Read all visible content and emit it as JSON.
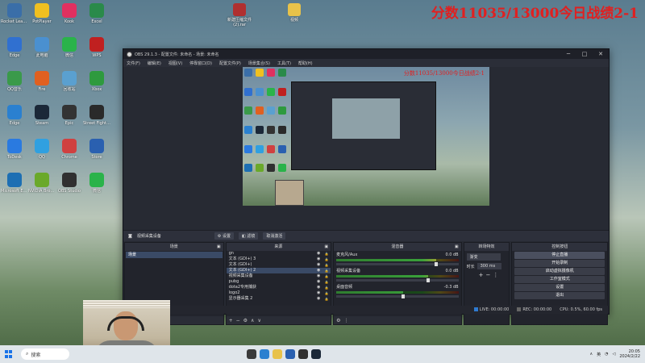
{
  "overlay_title": "分数11035/13000今日战绩2-1",
  "top_icons": [
    {
      "label": "新建压缩文件 (2).rar",
      "color": "#b03030",
      "icon": "archive-icon"
    },
    {
      "label": "视频",
      "color": "#e8c24a",
      "icon": "folder-icon"
    }
  ],
  "desktop_icons": [
    {
      "label": "Rocket\nLeague",
      "color": "#3a6ea8"
    },
    {
      "label": "PotPlayer",
      "color": "#f0c020"
    },
    {
      "label": "Kook",
      "color": "#e03060"
    },
    {
      "label": "Excel",
      "color": "#2a8a4a"
    },
    {
      "label": "Edge",
      "color": "#3070d0"
    },
    {
      "label": "此电脑",
      "color": "#4a90d0"
    },
    {
      "label": "微信",
      "color": "#2ab34a"
    },
    {
      "label": "WPS",
      "color": "#c02020"
    },
    {
      "label": "QQ音乐",
      "color": "#3a9a4a"
    },
    {
      "label": "Fire",
      "color": "#e06020"
    },
    {
      "label": "回收站",
      "color": "#5aa0d0"
    },
    {
      "label": "Xbox",
      "color": "#2e9a3e"
    },
    {
      "label": "Edge",
      "color": "#2a80d0"
    },
    {
      "label": "Steam",
      "color": "#1b2838"
    },
    {
      "label": "Epic",
      "color": "#333333"
    },
    {
      "label": "Street Fighter 6",
      "color": "#2a2a2a"
    },
    {
      "label": "ToDesk",
      "color": "#2a7ae0"
    },
    {
      "label": "QQ",
      "color": "#30a0e0"
    },
    {
      "label": "Chrome",
      "color": "#d04040"
    },
    {
      "label": "Store",
      "color": "#2a60b0"
    },
    {
      "label": "Microsoft Edge",
      "color": "#1d6fb3"
    },
    {
      "label": "NVIDIA Broadcast",
      "color": "#6aa92a"
    },
    {
      "label": "OBS Studio",
      "color": "#303030"
    },
    {
      "label": "微信",
      "color": "#2ab34a"
    }
  ],
  "obs": {
    "title": "OBS 29.1.3 - 配置文件: 未命名 - 场景: 未命名",
    "menu": [
      "文件(F)",
      "编辑(E)",
      "视图(V)",
      "停靠窗口(D)",
      "配置文件(P)",
      "场景集合(S)",
      "工具(T)",
      "帮助(H)"
    ],
    "preview_title": "分数11035/13000今日战绩2-1",
    "source_label": "视频采集设备",
    "settings_btn": "设置",
    "filters_btn": "滤镜",
    "deactivate_btn": "取消激活",
    "docks": {
      "scenes": {
        "title": "场景",
        "items": [
          "场景"
        ]
      },
      "sources": {
        "title": "来源",
        "items": [
          "gn",
          "文本 (GDI+) 3",
          "文本 (GDI+)",
          "文本 (GDI+) 2",
          "视频采集设备",
          "pubg",
          "dota2专用捕获",
          "logo2",
          "显示器采集 2"
        ]
      },
      "mixer": {
        "title": "混音器",
        "channels": [
          {
            "name": "麦克风/Aux",
            "db": "0.0 dB",
            "level": 0.82
          },
          {
            "name": "视频采集设备",
            "db": "0.0 dB",
            "level": 0.75
          },
          {
            "name": "桌面音频",
            "db": "-0.3 dB",
            "level": 0.55
          }
        ]
      },
      "transitions": {
        "title": "转场特效",
        "mode": "渐变",
        "duration_label": "时长",
        "duration": "300 ms"
      },
      "controls": {
        "title": "控制按钮",
        "buttons": [
          "停止直播",
          "开始录制",
          "启动虚拟摄像机",
          "工作室模式",
          "设置",
          "退出"
        ]
      }
    },
    "status": {
      "live": "LIVE: 00:00:00",
      "rec": "REC: 00:00:00",
      "cpu": "CPU: 0.5%, 60.00 fps"
    }
  },
  "taskbar": {
    "search": "搜索",
    "time": "20:05",
    "date": "2024/2/22",
    "lang": "英"
  }
}
